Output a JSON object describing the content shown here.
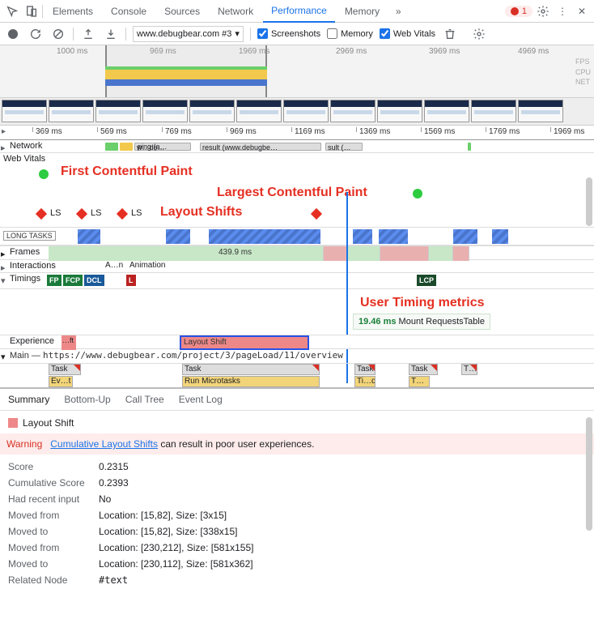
{
  "tabs": {
    "elements": "Elements",
    "console": "Console",
    "sources": "Sources",
    "network": "Network",
    "performance": "Performance",
    "memory": "Memory"
  },
  "errors": "1",
  "toolbar": {
    "recording_select": "www.debugbear.com #3",
    "screenshots": "Screenshots",
    "memory": "Memory",
    "web_vitals": "Web Vitals"
  },
  "overview": {
    "times": [
      "1000 ms",
      "969 ms",
      "1969 ms",
      "2969 ms",
      "3969 ms",
      "4969 ms"
    ],
    "lanes": [
      "FPS",
      "CPU",
      "NET"
    ]
  },
  "ruler_ticks": [
    "369 ms",
    "569 ms",
    "769 ms",
    "969 ms",
    "1169 ms",
    "1369 ms",
    "1569 ms",
    "1769 ms",
    "1969 ms"
  ],
  "rows": {
    "network": "Network",
    "web_vitals": "Web Vitals",
    "long_tasks": "LONG TASKS",
    "frames": "Frames",
    "interactions": "Interactions",
    "timings": "Timings",
    "experience": "Experience",
    "main": "Main",
    "main_url": "https://www.debugbear.com/project/3/pageLoad/11/overview"
  },
  "net_labels": [
    "w…de…",
    "ping (a…",
    "result (www.debugbe…",
    "sult (…"
  ],
  "annotations": {
    "fcp": "First Contentful Paint",
    "lcp": "Largest Contentful Paint",
    "ls_header": "Layout Shifts",
    "ls": "LS",
    "utm": "User Timing metrics"
  },
  "frames_label": "439.9 ms",
  "interactions_items": [
    "A…n",
    "Animation"
  ],
  "timing_badges": {
    "fp": "FP",
    "fcp": "FCP",
    "dcl": "DCL",
    "l": "L",
    "lcp": "LCP"
  },
  "experience": {
    "shift_label": "…ft",
    "layout_shift": "Layout Shift"
  },
  "tooltip": {
    "ms": "19.46 ms",
    "txt": "Mount RequestsTable"
  },
  "flame": {
    "task": "Task",
    "evt": "Ev…t",
    "run_micro": "Run Microtasks",
    "tid": "Ti…d",
    "t": "T…"
  },
  "bottom_tabs": {
    "summary": "Summary",
    "bottom_up": "Bottom-Up",
    "call_tree": "Call Tree",
    "event_log": "Event Log"
  },
  "details": {
    "title": "Layout Shift",
    "warn_label": "Warning",
    "warn_link": "Cumulative Layout Shifts",
    "warn_rest": " can result in poor user experiences.",
    "score_k": "Score",
    "score_v": "0.2315",
    "cscore_k": "Cumulative Score",
    "cscore_v": "0.2393",
    "recent_k": "Had recent input",
    "recent_v": "No",
    "mf1_k": "Moved from",
    "mf1_v": "Location: [15,82], Size: [3x15]",
    "mt1_k": "Moved to",
    "mt1_v": "Location: [15,82], Size: [338x15]",
    "mf2_k": "Moved from",
    "mf2_v": "Location: [230,212], Size: [581x155]",
    "mt2_k": "Moved to",
    "mt2_v": "Location: [230,112], Size: [581x362]",
    "rel_k": "Related Node",
    "rel_v": "#text"
  }
}
